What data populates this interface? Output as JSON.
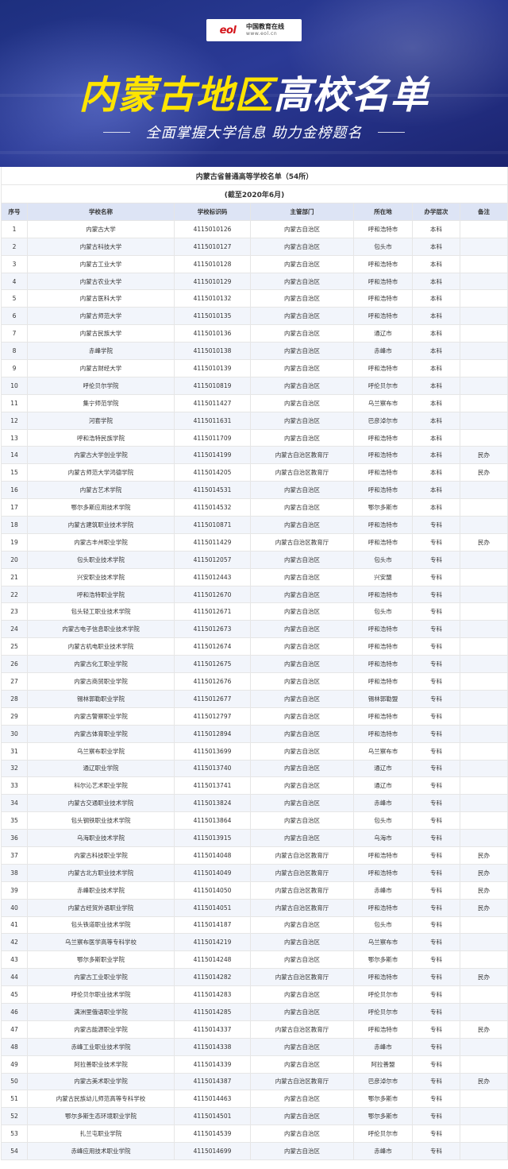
{
  "header": {
    "logo_mark": "eol",
    "logo_name": "中国教育在线",
    "logo_url": "www.eol.cn",
    "title_part1": "内蒙古地区",
    "title_part2": "高校名单",
    "subtitle": "全面掌握大学信息  助力金榜题名"
  },
  "table": {
    "title": "内蒙古省普通高等学校名单（54所）",
    "date": "(截至2020年6月)",
    "columns": [
      "序号",
      "学校名称",
      "学校标识码",
      "主管部门",
      "所在地",
      "办学层次",
      "备注"
    ],
    "rows": [
      [
        "1",
        "内蒙古大学",
        "4115010126",
        "内蒙古自治区",
        "呼和浩特市",
        "本科",
        ""
      ],
      [
        "2",
        "内蒙古科技大学",
        "4115010127",
        "内蒙古自治区",
        "包头市",
        "本科",
        ""
      ],
      [
        "3",
        "内蒙古工业大学",
        "4115010128",
        "内蒙古自治区",
        "呼和浩特市",
        "本科",
        ""
      ],
      [
        "4",
        "内蒙古农业大学",
        "4115010129",
        "内蒙古自治区",
        "呼和浩特市",
        "本科",
        ""
      ],
      [
        "5",
        "内蒙古医科大学",
        "4115010132",
        "内蒙古自治区",
        "呼和浩特市",
        "本科",
        ""
      ],
      [
        "6",
        "内蒙古师范大学",
        "4115010135",
        "内蒙古自治区",
        "呼和浩特市",
        "本科",
        ""
      ],
      [
        "7",
        "内蒙古民族大学",
        "4115010136",
        "内蒙古自治区",
        "通辽市",
        "本科",
        ""
      ],
      [
        "8",
        "赤峰学院",
        "4115010138",
        "内蒙古自治区",
        "赤峰市",
        "本科",
        ""
      ],
      [
        "9",
        "内蒙古财经大学",
        "4115010139",
        "内蒙古自治区",
        "呼和浩特市",
        "本科",
        ""
      ],
      [
        "10",
        "呼伦贝尔学院",
        "4115010819",
        "内蒙古自治区",
        "呼伦贝尔市",
        "本科",
        ""
      ],
      [
        "11",
        "集宁师范学院",
        "4115011427",
        "内蒙古自治区",
        "乌兰察布市",
        "本科",
        ""
      ],
      [
        "12",
        "河套学院",
        "4115011631",
        "内蒙古自治区",
        "巴彦淖尔市",
        "本科",
        ""
      ],
      [
        "13",
        "呼和浩特民族学院",
        "4115011709",
        "内蒙古自治区",
        "呼和浩特市",
        "本科",
        ""
      ],
      [
        "14",
        "内蒙古大学创业学院",
        "4115014199",
        "内蒙古自治区教育厅",
        "呼和浩特市",
        "本科",
        "民办"
      ],
      [
        "15",
        "内蒙古师范大学鸿德学院",
        "4115014205",
        "内蒙古自治区教育厅",
        "呼和浩特市",
        "本科",
        "民办"
      ],
      [
        "16",
        "内蒙古艺术学院",
        "4115014531",
        "内蒙古自治区",
        "呼和浩特市",
        "本科",
        ""
      ],
      [
        "17",
        "鄂尔多斯应用技术学院",
        "4115014532",
        "内蒙古自治区",
        "鄂尔多斯市",
        "本科",
        ""
      ],
      [
        "18",
        "内蒙古建筑职业技术学院",
        "4115010871",
        "内蒙古自治区",
        "呼和浩特市",
        "专科",
        ""
      ],
      [
        "19",
        "内蒙古丰州职业学院",
        "4115011429",
        "内蒙古自治区教育厅",
        "呼和浩特市",
        "专科",
        "民办"
      ],
      [
        "20",
        "包头职业技术学院",
        "4115012057",
        "内蒙古自治区",
        "包头市",
        "专科",
        ""
      ],
      [
        "21",
        "兴安职业技术学院",
        "4115012443",
        "内蒙古自治区",
        "兴安盟",
        "专科",
        ""
      ],
      [
        "22",
        "呼和浩特职业学院",
        "4115012670",
        "内蒙古自治区",
        "呼和浩特市",
        "专科",
        ""
      ],
      [
        "23",
        "包头轻工职业技术学院",
        "4115012671",
        "内蒙古自治区",
        "包头市",
        "专科",
        ""
      ],
      [
        "24",
        "内蒙古电子信息职业技术学院",
        "4115012673",
        "内蒙古自治区",
        "呼和浩特市",
        "专科",
        ""
      ],
      [
        "25",
        "内蒙古机电职业技术学院",
        "4115012674",
        "内蒙古自治区",
        "呼和浩特市",
        "专科",
        ""
      ],
      [
        "26",
        "内蒙古化工职业学院",
        "4115012675",
        "内蒙古自治区",
        "呼和浩特市",
        "专科",
        ""
      ],
      [
        "27",
        "内蒙古商贸职业学院",
        "4115012676",
        "内蒙古自治区",
        "呼和浩特市",
        "专科",
        ""
      ],
      [
        "28",
        "锡林郭勒职业学院",
        "4115012677",
        "内蒙古自治区",
        "锡林郭勒盟",
        "专科",
        ""
      ],
      [
        "29",
        "内蒙古警察职业学院",
        "4115012797",
        "内蒙古自治区",
        "呼和浩特市",
        "专科",
        ""
      ],
      [
        "30",
        "内蒙古体育职业学院",
        "4115012894",
        "内蒙古自治区",
        "呼和浩特市",
        "专科",
        ""
      ],
      [
        "31",
        "乌兰察布职业学院",
        "4115013699",
        "内蒙古自治区",
        "乌兰察布市",
        "专科",
        ""
      ],
      [
        "32",
        "通辽职业学院",
        "4115013740",
        "内蒙古自治区",
        "通辽市",
        "专科",
        ""
      ],
      [
        "33",
        "科尔沁艺术职业学院",
        "4115013741",
        "内蒙古自治区",
        "通辽市",
        "专科",
        ""
      ],
      [
        "34",
        "内蒙古交通职业技术学院",
        "4115013824",
        "内蒙古自治区",
        "赤峰市",
        "专科",
        ""
      ],
      [
        "35",
        "包头钢铁职业技术学院",
        "4115013864",
        "内蒙古自治区",
        "包头市",
        "专科",
        ""
      ],
      [
        "36",
        "乌海职业技术学院",
        "4115013915",
        "内蒙古自治区",
        "乌海市",
        "专科",
        ""
      ],
      [
        "37",
        "内蒙古科技职业学院",
        "4115014048",
        "内蒙古自治区教育厅",
        "呼和浩特市",
        "专科",
        "民办"
      ],
      [
        "38",
        "内蒙古北方职业技术学院",
        "4115014049",
        "内蒙古自治区教育厅",
        "呼和浩特市",
        "专科",
        "民办"
      ],
      [
        "39",
        "赤峰职业技术学院",
        "4115014050",
        "内蒙古自治区教育厅",
        "赤峰市",
        "专科",
        "民办"
      ],
      [
        "40",
        "内蒙古经贸外语职业学院",
        "4115014051",
        "内蒙古自治区教育厅",
        "呼和浩特市",
        "专科",
        "民办"
      ],
      [
        "41",
        "包头铁道职业技术学院",
        "4115014187",
        "内蒙古自治区",
        "包头市",
        "专科",
        ""
      ],
      [
        "42",
        "乌兰察布医学高等专科学校",
        "4115014219",
        "内蒙古自治区",
        "乌兰察布市",
        "专科",
        ""
      ],
      [
        "43",
        "鄂尔多斯职业学院",
        "4115014248",
        "内蒙古自治区",
        "鄂尔多斯市",
        "专科",
        ""
      ],
      [
        "44",
        "内蒙古工业职业学院",
        "4115014282",
        "内蒙古自治区教育厅",
        "呼和浩特市",
        "专科",
        "民办"
      ],
      [
        "45",
        "呼伦贝尔职业技术学院",
        "4115014283",
        "内蒙古自治区",
        "呼伦贝尔市",
        "专科",
        ""
      ],
      [
        "46",
        "满洲里俄语职业学院",
        "4115014285",
        "内蒙古自治区",
        "呼伦贝尔市",
        "专科",
        ""
      ],
      [
        "47",
        "内蒙古能源职业学院",
        "4115014337",
        "内蒙古自治区教育厅",
        "呼和浩特市",
        "专科",
        "民办"
      ],
      [
        "48",
        "赤峰工业职业技术学院",
        "4115014338",
        "内蒙古自治区",
        "赤峰市",
        "专科",
        ""
      ],
      [
        "49",
        "阿拉善职业技术学院",
        "4115014339",
        "内蒙古自治区",
        "阿拉善盟",
        "专科",
        ""
      ],
      [
        "50",
        "内蒙古美术职业学院",
        "4115014387",
        "内蒙古自治区教育厅",
        "巴彦淖尔市",
        "专科",
        "民办"
      ],
      [
        "51",
        "内蒙古民族幼儿师范高等专科学校",
        "4115014463",
        "内蒙古自治区",
        "鄂尔多斯市",
        "专科",
        ""
      ],
      [
        "52",
        "鄂尔多斯生态环境职业学院",
        "4115014501",
        "内蒙古自治区",
        "鄂尔多斯市",
        "专科",
        ""
      ],
      [
        "53",
        "扎兰屯职业学院",
        "4115014539",
        "内蒙古自治区",
        "呼伦贝尔市",
        "专科",
        ""
      ],
      [
        "54",
        "赤峰应用技术职业学院",
        "4115014699",
        "内蒙古自治区",
        "赤峰市",
        "专科",
        ""
      ]
    ]
  }
}
